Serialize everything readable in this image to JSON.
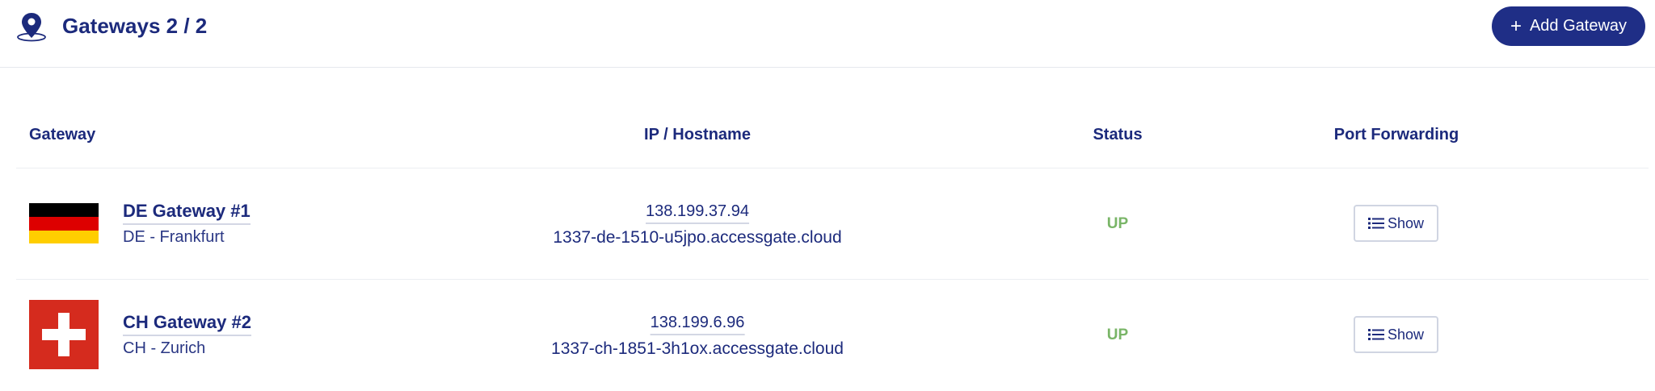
{
  "header": {
    "title": "Gateways 2 / 2",
    "add_button_label": "Add Gateway",
    "icon": "map-pin-icon"
  },
  "table": {
    "columns": [
      "Gateway",
      "IP / Hostname",
      "Status",
      "Port Forwarding"
    ],
    "rows": [
      {
        "flag": "germany-flag",
        "name": "DE Gateway #1",
        "location": "DE - Frankfurt",
        "ip": "138.199.37.94",
        "hostname": "1337-de-1510-u5jpo.accessgate.cloud",
        "status": "UP",
        "port_forwarding_label": "Show"
      },
      {
        "flag": "switzerland-flag",
        "name": "CH Gateway #2",
        "location": "CH - Zurich",
        "ip": "138.199.6.96",
        "hostname": "1337-ch-1851-3h1ox.accessgate.cloud",
        "status": "UP",
        "port_forwarding_label": "Show"
      }
    ]
  },
  "colors": {
    "primary": "#1f2e86",
    "text": "#1c2a7c",
    "status_up": "#79b567",
    "flag_black": "#000000",
    "flag_red": "#dd0000",
    "flag_gold": "#ffce00",
    "swiss_red": "#d52b1e"
  }
}
